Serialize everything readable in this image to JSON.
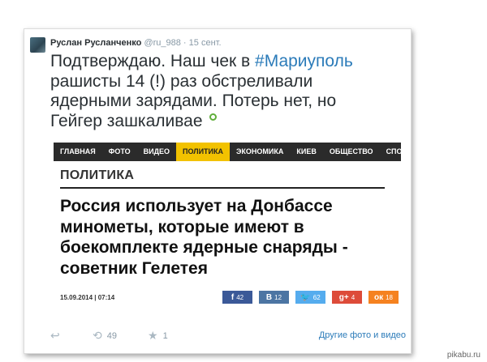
{
  "tweet": {
    "author_name": "Руслан Русланченко",
    "handle": "@ru_988",
    "separator": " · ",
    "date": "15 сент.",
    "text_before": "Подтверждаю. Наш чек в ",
    "hashtag": "#Мариуполь",
    "text_after": " рашисты 14 (!) раз обстреливали ядерными зарядами. Потерь нет, но Гейгер зашкаливае"
  },
  "article": {
    "nav": [
      "ГЛАВНАЯ",
      "ФОТО",
      "ВИДЕО",
      "ПОЛИТИКА",
      "ЭКОНОМИКА",
      "КИЕВ",
      "ОБЩЕСТВО",
      "СПОР"
    ],
    "active_nav": "ПОЛИТИКА",
    "section": "ПОЛИТИКА",
    "headline": "Россия использует на Донбассе минометы, которые имеют в боекомплекте ядерные снаряды - советник Гелетея",
    "date": "15.09.2014 | 07:14",
    "shares": [
      {
        "icon": "f",
        "count": "42",
        "color": "#3b5998",
        "name": "facebook"
      },
      {
        "icon": "В",
        "count": "12",
        "color": "#4c75a3",
        "name": "vk"
      },
      {
        "icon": "🐦",
        "count": "62",
        "color": "#55acee",
        "name": "twitter"
      },
      {
        "icon": "g+",
        "count": "4",
        "color": "#dd4b39",
        "name": "google-plus"
      },
      {
        "icon": "ок",
        "count": "18",
        "color": "#f58220",
        "name": "odnoklassniki"
      }
    ]
  },
  "actions": {
    "reply_icon": "↩",
    "retweet_icon": "⟲",
    "retweet_count": "49",
    "favorite_icon": "★",
    "favorite_count": "1",
    "more_link": "Другие фото и видео"
  },
  "watermark": "pikabu.ru"
}
